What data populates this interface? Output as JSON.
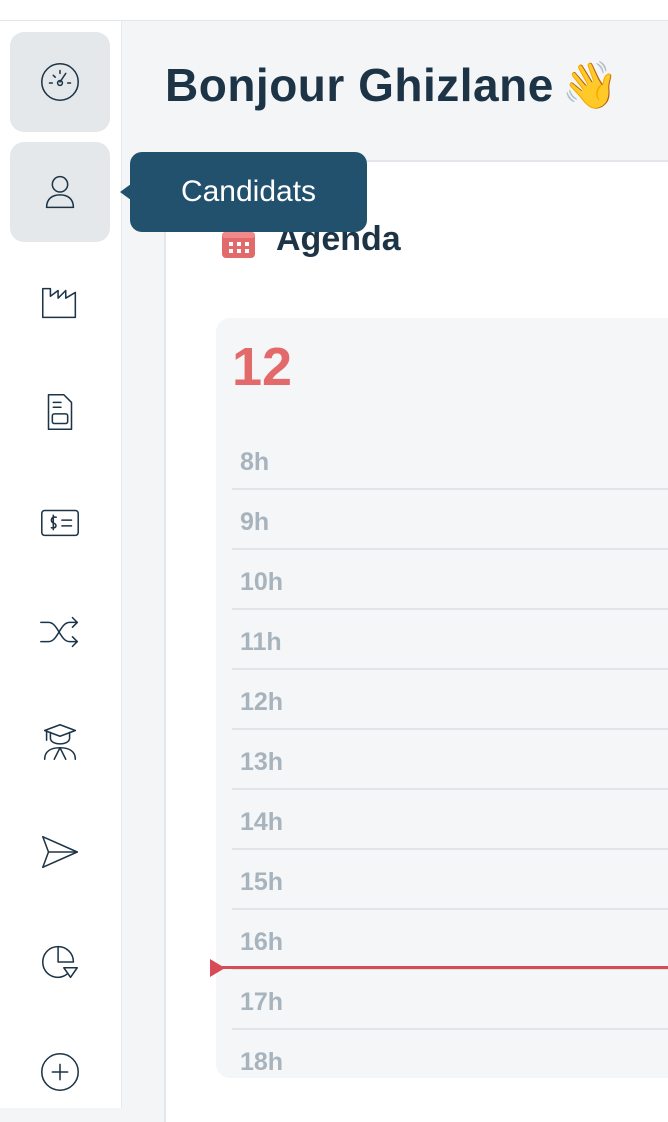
{
  "greeting": {
    "text": "Bonjour Ghizlane",
    "emoji": "👋"
  },
  "tooltip": {
    "label": "Candidats"
  },
  "sidebar": {
    "items": [
      {
        "name": "dashboard",
        "icon": "gauge-icon",
        "active": true
      },
      {
        "name": "candidats",
        "icon": "user-icon",
        "active": true
      },
      {
        "name": "entreprises",
        "icon": "factory-icon",
        "active": false
      },
      {
        "name": "documents",
        "icon": "document-icon",
        "active": false
      },
      {
        "name": "facturation",
        "icon": "money-card-icon",
        "active": false
      },
      {
        "name": "matching",
        "icon": "shuffle-icon",
        "active": false
      },
      {
        "name": "formation",
        "icon": "graduate-icon",
        "active": false
      },
      {
        "name": "envois",
        "icon": "send-icon",
        "active": false
      },
      {
        "name": "statistiques",
        "icon": "pie-chart-icon",
        "active": false
      },
      {
        "name": "ajouter",
        "icon": "plus-circle-icon",
        "active": false
      }
    ]
  },
  "agenda": {
    "title": "Agenda",
    "day": "12",
    "hours": [
      "8h",
      "9h",
      "10h",
      "11h",
      "12h",
      "13h",
      "14h",
      "15h",
      "16h",
      "17h",
      "18h"
    ]
  },
  "colors": {
    "primary": "#1d3446",
    "tooltip": "#22516e",
    "accent": "#e36a6a",
    "now_line": "#d64b55"
  }
}
